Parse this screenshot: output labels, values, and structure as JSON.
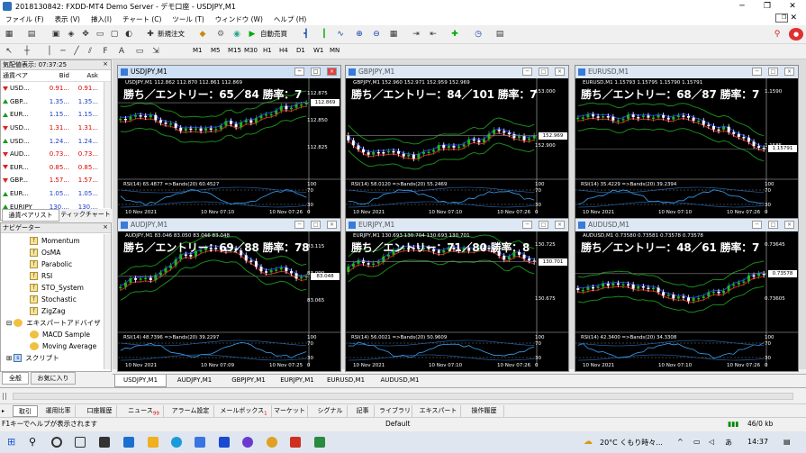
{
  "window": {
    "title": "2018130842: FXDD-MT4 Demo Server - デモ口座 - USDJPY,M1"
  },
  "menu": [
    "ファイル (F)",
    "表示 (V)",
    "挿入(I)",
    "チャート (C)",
    "ツール (T)",
    "ウィンドウ (W)",
    "ヘルプ (H)"
  ],
  "toolbar": {
    "new_order": "新規注文",
    "auto_trade": "自動売買"
  },
  "timeframes": [
    "M1",
    "M5",
    "M15",
    "M30",
    "H1",
    "H4",
    "D1",
    "W1",
    "MN"
  ],
  "market_watch": {
    "title": "気配値表示: 07:37:25",
    "headers": [
      "通貨ペア",
      "Bid",
      "Ask"
    ],
    "rows": [
      {
        "symbol": "USD...",
        "bid": "0.91...",
        "ask": "0.91...",
        "dir": "down"
      },
      {
        "symbol": "GBP...",
        "bid": "1.35...",
        "ask": "1.35...",
        "dir": "up"
      },
      {
        "symbol": "EUR...",
        "bid": "1.15...",
        "ask": "1.15...",
        "dir": "up"
      },
      {
        "symbol": "USD...",
        "bid": "1.31...",
        "ask": "1.31...",
        "dir": "down"
      },
      {
        "symbol": "USD...",
        "bid": "1.24...",
        "ask": "1.24...",
        "dir": "up"
      },
      {
        "symbol": "AUD...",
        "bid": "0.73...",
        "ask": "0.73...",
        "dir": "down"
      },
      {
        "symbol": "EUR...",
        "bid": "0.85...",
        "ask": "0.85...",
        "dir": "down"
      },
      {
        "symbol": "GBP...",
        "bid": "1.57...",
        "ask": "1.57...",
        "dir": "down"
      },
      {
        "symbol": "EUR...",
        "bid": "1.05...",
        "ask": "1.05...",
        "dir": "up"
      },
      {
        "symbol": "EURJPY",
        "bid": "130....",
        "ask": "130....",
        "dir": "up"
      }
    ],
    "tabs": [
      "通貨ペアリスト",
      "ティックチャート"
    ]
  },
  "navigator": {
    "title": "ナビゲーター",
    "indicators": [
      "Momentum",
      "OsMA",
      "Parabolic",
      "RSI",
      "STO_System",
      "Stochastic",
      "ZigZag"
    ],
    "ea_folder": "エキスパートアドバイザ",
    "experts": [
      "MACD Sample",
      "Moving Average"
    ],
    "script_folder": "スクリプト",
    "tabs": [
      "全般",
      "お気に入り"
    ]
  },
  "charts": [
    {
      "title": "USDJPY,M1",
      "info": "USDJPY,M1  112.862 112.870 112.861 112.869",
      "win": "勝ち／エントリー：65／84 勝率：7",
      "prices": [
        "112.875",
        "112.850",
        "112.825"
      ],
      "cur": "112.869",
      "rsi": "RSI(14) 65.4877   =>Bands(20) 60.4527",
      "times": [
        "10 Nov 2021",
        "10 Nov 07:10",
        "10 Nov 07:26"
      ],
      "active": true
    },
    {
      "title": "GBPJPY,M1",
      "info": "GBPJPY,M1  152.960 152.971 152.959 152.969",
      "win": "勝ち／エントリー：84／101 勝率：7",
      "prices": [
        "153.000",
        "152.900"
      ],
      "cur": "152.969",
      "rsi": "RSI(14) 58.0120   =>Bands(20) 55.2469",
      "times": [
        "10 Nov 2021",
        "10 Nov 07:10",
        "10 Nov 07:26"
      ],
      "active": false
    },
    {
      "title": "EURUSD,M1",
      "info": "EURUSD,M1  1.15793 1.15795 1.15790 1.15791",
      "win": "勝ち／エントリー：68／87 勝率：7",
      "prices": [
        "1.1590",
        "1.1585"
      ],
      "cur": "1.15791",
      "rsi": "RSI(14) 35.4229   =>Bands(20) 39.2394",
      "times": [
        "10 Nov 2021",
        "10 Nov 07:10",
        "10 Nov 07:26"
      ],
      "active": false
    },
    {
      "title": "AUDJPY,M1",
      "info": "AUDJPY,M1  83.046 83.050 83.046 83.048",
      "win": "勝ち／エントリー：69／88 勝率：78",
      "prices": [
        "83.115",
        "83.090",
        "83.065"
      ],
      "cur": "83.048",
      "rsi": "RSI(14) 48.7396   =>Bands(20) 39.2297",
      "times": [
        "10 Nov 2021",
        "10 Nov 07:09",
        "10 Nov 07:25"
      ],
      "active": false
    },
    {
      "title": "EURJPY,M1",
      "info": "EURJPY,M1  130.693 130.704 130.693 130.701",
      "win": "勝ち／エントリー：71／80 勝率：8",
      "prices": [
        "130.725",
        "130.675"
      ],
      "cur": "130.701",
      "rsi": "RSI(14) 56.0021   =>Bands(20) 50.9609",
      "times": [
        "10 Nov 2021",
        "10 Nov 07:10",
        "10 Nov 07:26"
      ],
      "active": false
    },
    {
      "title": "AUDUSD,M1",
      "info": "AUDUSD,M1  0.73580 0.73581 0.73578 0.73578",
      "win": "勝ち／エントリー：48／61 勝率：7",
      "prices": [
        "0.73645",
        "0.73605"
      ],
      "cur": "0.73578",
      "rsi": "RSI(14) 42.3400   =>Bands(20) 34.3308",
      "times": [
        "10 Nov 2021",
        "10 Nov 07:10",
        "10 Nov 07:26"
      ],
      "active": false
    }
  ],
  "rsi_levels": [
    "100",
    "70",
    "30",
    "0"
  ],
  "symbol_tabs": [
    "USDJPY,M1",
    "AUDJPY,M1",
    "GBPJPY,M1",
    "EURJPY,M1",
    "EURUSD,M1",
    "AUDUSD,M1"
  ],
  "terminal_tabs": [
    "取引",
    "運用比率",
    "口座履歴",
    "ニュース",
    "アラーム設定",
    "メールボックス",
    "マーケット",
    "シグナル",
    "記事",
    "ライブラリ",
    "エキスパート",
    "操作履歴"
  ],
  "news_count": "99",
  "mail_count": "1",
  "status": {
    "help": "F1キーでヘルプが表示されます",
    "profile": "Default",
    "traffic": "46/0 kb"
  },
  "taskbar": {
    "weather": "20°C くもり時々...",
    "time": "14:37"
  },
  "colors": {
    "bull": "#22b422",
    "bear": "#ffffff",
    "ma1": "#e02020",
    "ma2": "#2040ff",
    "band": "#1a8a1a"
  }
}
